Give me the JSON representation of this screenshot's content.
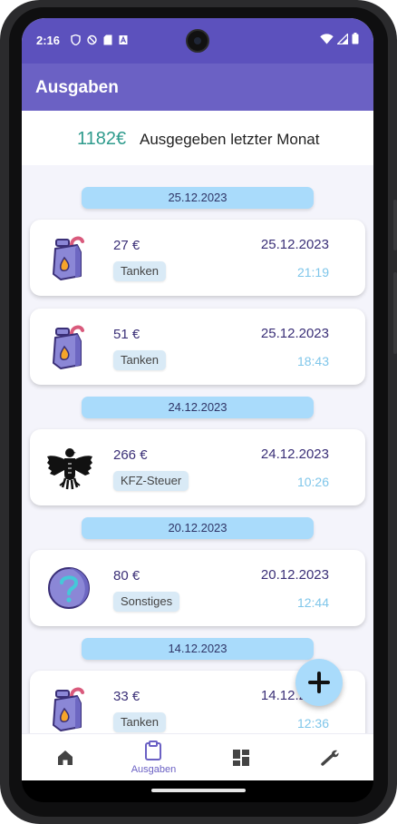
{
  "status_bar": {
    "time": "2:16",
    "left_icons": [
      "shield-icon",
      "no-sim-icon",
      "sd-card-icon",
      "keyboard-icon"
    ],
    "right_icons": [
      "wifi-icon",
      "signal-icon",
      "battery-icon"
    ]
  },
  "app_bar": {
    "title": "Ausgaben"
  },
  "summary": {
    "amount": "1182€",
    "label": "Ausgegeben letzter Monat"
  },
  "groups": [
    {
      "date": "25.12.2023",
      "entries": [
        {
          "amount": "27 €",
          "category": "Tanken",
          "date": "25.12.2023",
          "time": "21:19",
          "icon": "fuel-can-icon"
        },
        {
          "amount": "51 €",
          "category": "Tanken",
          "date": "25.12.2023",
          "time": "18:43",
          "icon": "fuel-can-icon"
        }
      ]
    },
    {
      "date": "24.12.2023",
      "entries": [
        {
          "amount": "266 €",
          "category": "KFZ-Steuer",
          "date": "24.12.2023",
          "time": "10:26",
          "icon": "federal-eagle-icon"
        }
      ]
    },
    {
      "date": "20.12.2023",
      "entries": [
        {
          "amount": "80 €",
          "category": "Sonstiges",
          "date": "20.12.2023",
          "time": "12:44",
          "icon": "question-mark-icon"
        }
      ]
    },
    {
      "date": "14.12.2023",
      "entries": [
        {
          "amount": "33 €",
          "category": "Tanken",
          "date": "14.12.2023",
          "time": "12:36",
          "icon": "fuel-can-icon"
        }
      ]
    }
  ],
  "fab": {
    "icon": "plus-icon"
  },
  "bottom_nav": [
    {
      "icon": "home-icon",
      "label": ""
    },
    {
      "icon": "clipboard-icon",
      "label": "Ausgaben",
      "active": true
    },
    {
      "icon": "dashboard-icon",
      "label": ""
    },
    {
      "icon": "wrench-icon",
      "label": ""
    }
  ],
  "colors": {
    "status_bar": "#5c51bd",
    "app_bar": "#6b61c4",
    "accent_amount": "#2f9b8d",
    "date_pill": "#a9dbfb",
    "time_text": "#7fc6ea",
    "text_primary": "#3a2f77"
  }
}
